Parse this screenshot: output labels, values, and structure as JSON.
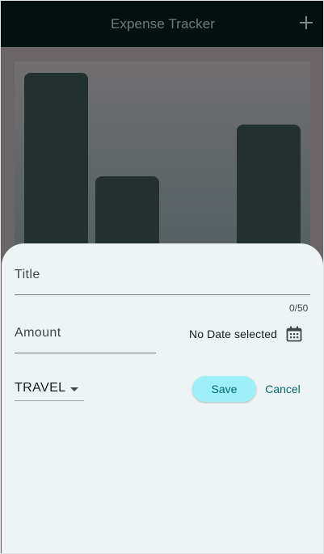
{
  "app_bar": {
    "title": "Expense Tracker",
    "add_icon": "plus-icon",
    "background": "#01110f"
  },
  "chart": {
    "bars": [
      {
        "category": "bar-1",
        "fill": 0.87
      },
      {
        "category": "bar-2",
        "fill": 0.34
      },
      {
        "category": "bar-3",
        "fill": 0.6
      },
      {
        "category": "bar-4",
        "fill": 0.6
      }
    ],
    "visible_bars": [
      0,
      1,
      3
    ],
    "bar_color": "#233030"
  },
  "form": {
    "title_label": "Title",
    "title_counter": "0/50",
    "amount_label": "Amount",
    "date_text": "No Date selected",
    "date_icon": "calendar-icon",
    "category_value": "TRAVEL",
    "category_icon": "dropdown-arrow-icon",
    "save_label": "Save",
    "cancel_label": "Cancel",
    "accent_color": "#00696f",
    "save_color": "#9df0f8"
  }
}
